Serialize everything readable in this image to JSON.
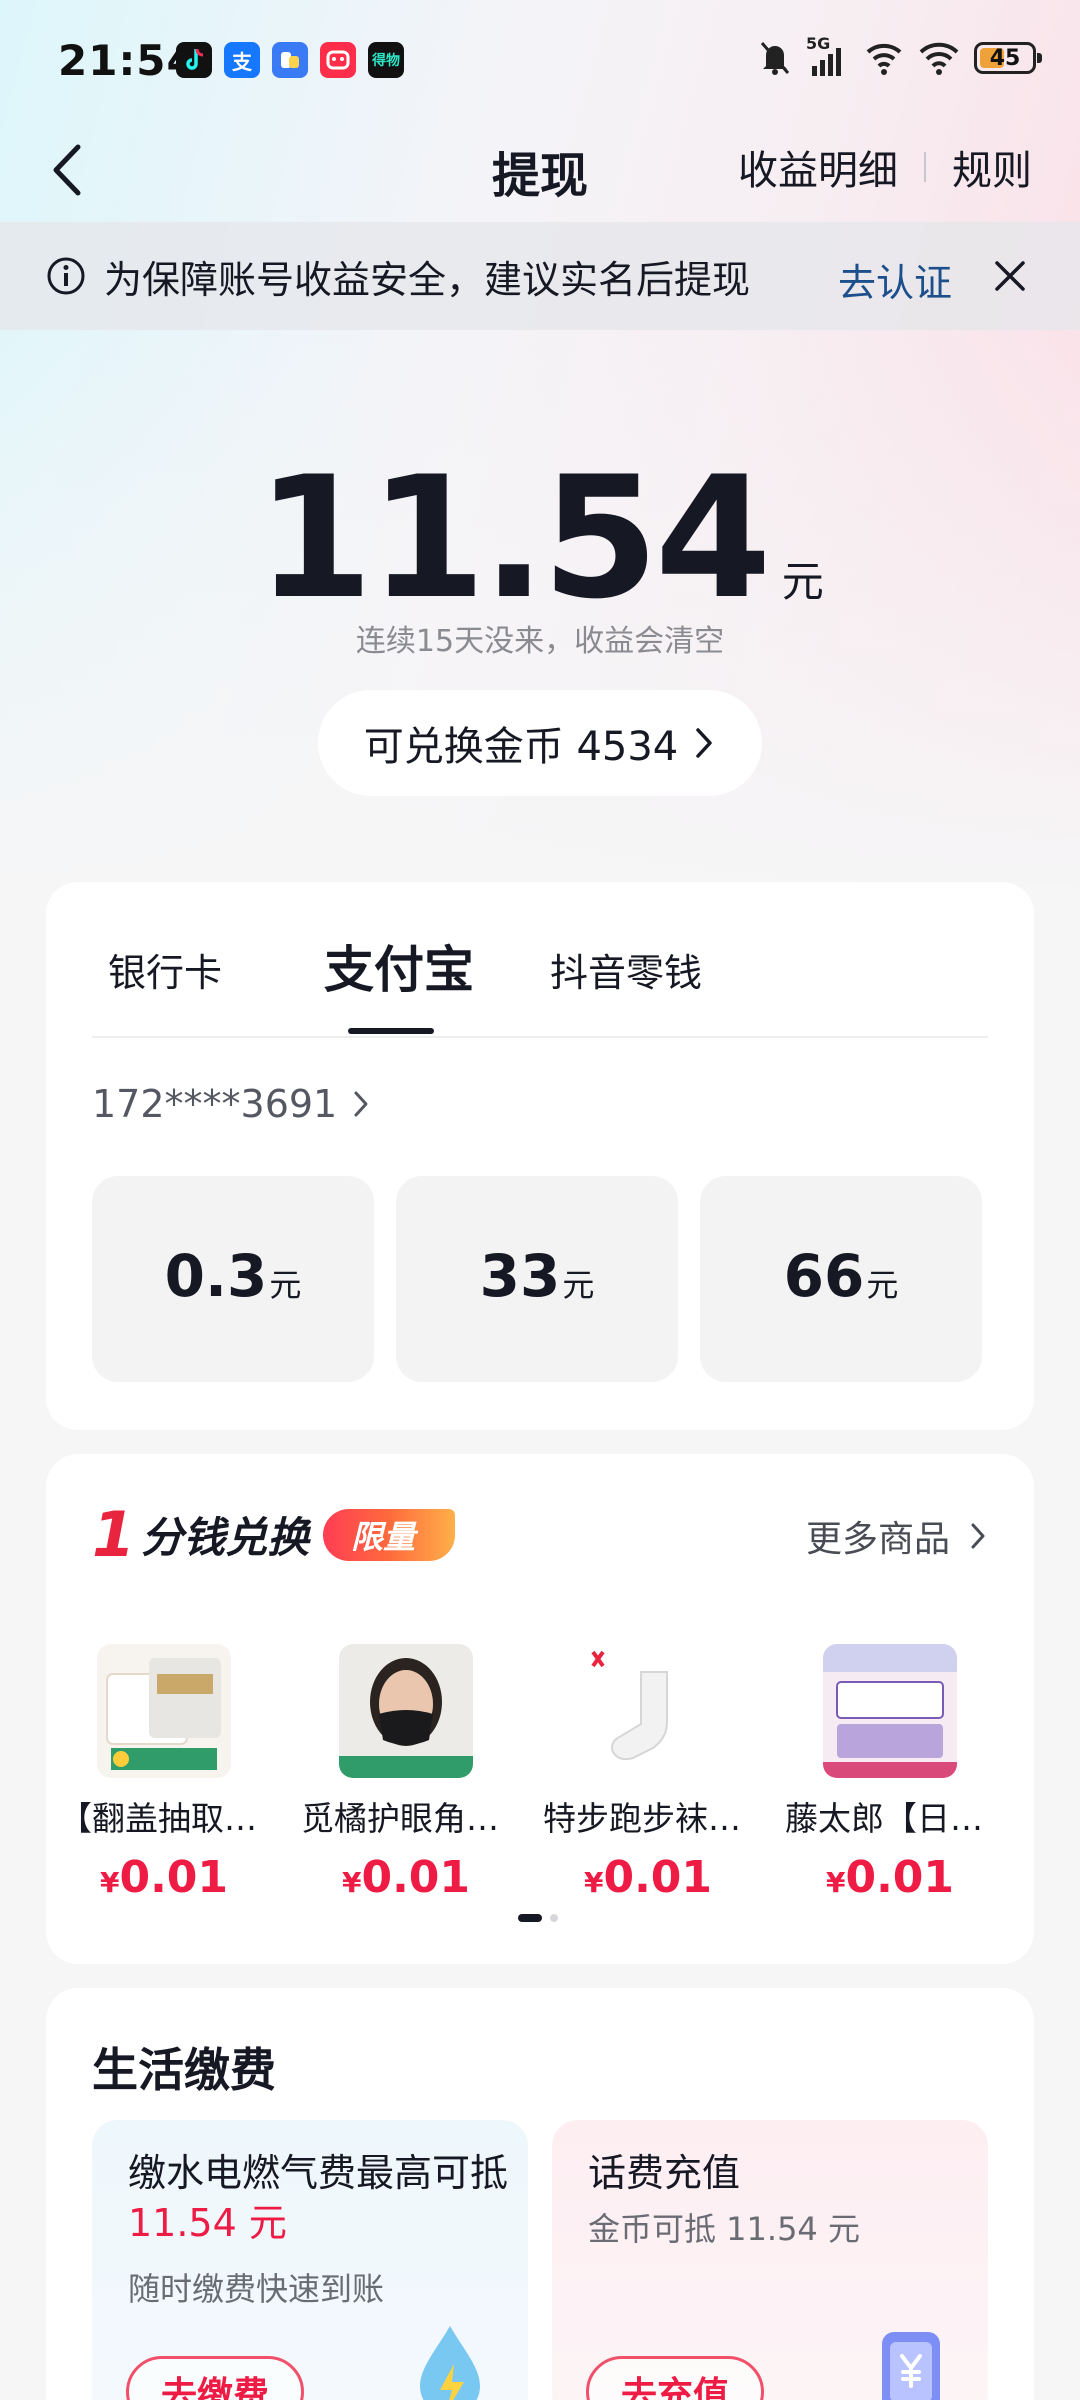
{
  "status_bar": {
    "time": "21:54",
    "notification_apps": [
      "douyin-icon",
      "alipay-icon",
      "baidu-icon",
      "tmall-icon",
      "dewu-icon"
    ],
    "dewu_label": "得物",
    "alipay_label": "支",
    "network": "5G",
    "battery": "45"
  },
  "nav": {
    "title": "提现",
    "details_label": "收益明细",
    "rules_label": "规则"
  },
  "banner": {
    "message": "为保障账号收益安全，建议实名后提现",
    "action": "去认证"
  },
  "balance": {
    "amount": "11.54",
    "unit": "元",
    "hint": "连续15天没来，收益会清空",
    "coins_label": "可兑换金币 4534"
  },
  "withdraw": {
    "tabs": [
      {
        "label": "银行卡",
        "active": false
      },
      {
        "label": "支付宝",
        "active": true
      },
      {
        "label": "抖音零钱",
        "active": false
      }
    ],
    "account": "172****3691",
    "options": [
      {
        "value": "0.3",
        "unit": "元"
      },
      {
        "value": "33",
        "unit": "元"
      },
      {
        "value": "66",
        "unit": "元"
      }
    ]
  },
  "exchange": {
    "title_number": "1",
    "title_text": "分钱兑换",
    "badge": "限量",
    "more_label": "更多商品",
    "products": [
      {
        "name": "【翻盖抽取式…",
        "currency": "¥",
        "price": "0.01"
      },
      {
        "name": "觅橘护眼角口罩…",
        "currency": "¥",
        "price": "0.01"
      },
      {
        "name": "特步跑步袜子…",
        "currency": "¥",
        "price": "0.01"
      },
      {
        "name": "藤太郎【日本…",
        "currency": "¥",
        "price": "0.01"
      }
    ]
  },
  "life": {
    "title": "生活缴费",
    "utilities": {
      "title": "缴水电燃气费最高可抵",
      "highlight": "11.54 元",
      "subtitle": "随时缴费快速到账",
      "button": "去缴费"
    },
    "phone": {
      "title": "话费充值",
      "subtitle": "金币可抵 11.54 元",
      "button": "去充值"
    }
  },
  "colors": {
    "accent_red": "#ee1c45",
    "link_blue": "#1d4f8c",
    "text_primary": "#161823"
  }
}
